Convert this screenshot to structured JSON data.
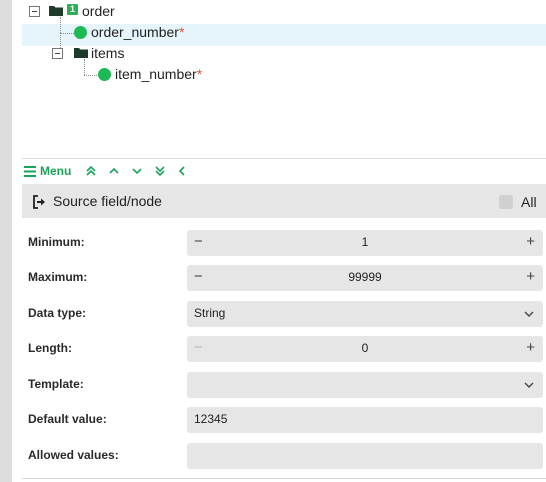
{
  "tree": {
    "root": {
      "label": "order",
      "badge": "1"
    },
    "order_number": {
      "label": "order_number",
      "required_mark": "*"
    },
    "items": {
      "label": "items"
    },
    "item_number": {
      "label": "item_number",
      "required_mark": "*"
    }
  },
  "menubar": {
    "menu_label": "Menu",
    "icons": [
      "double-chevron-up-icon",
      "chevron-up-icon",
      "chevron-down-icon",
      "double-chevron-down-icon",
      "chevron-left-icon"
    ]
  },
  "source": {
    "label": "Source field/node",
    "all_label": "All",
    "all_checked": false
  },
  "fields": {
    "minimum": {
      "label": "Minimum:",
      "value": "1",
      "minus": "−",
      "plus": "+"
    },
    "maximum": {
      "label": "Maximum:",
      "value": "99999",
      "minus": "−",
      "plus": "+"
    },
    "data_type": {
      "label": "Data type:",
      "value": "String"
    },
    "length": {
      "label": "Length:",
      "value": "0",
      "minus": "−",
      "plus": "+"
    },
    "template": {
      "label": "Template:",
      "value": ""
    },
    "default_value": {
      "label": "Default value:",
      "value": "12345"
    },
    "allowed_values": {
      "label": "Allowed values:",
      "value": ""
    }
  },
  "colors": {
    "accent": "#1aa45a",
    "node_dot": "#1db954",
    "required": "#e0533a",
    "selected_row": "#e6f4fb",
    "field_bg": "#e6e6e6"
  }
}
